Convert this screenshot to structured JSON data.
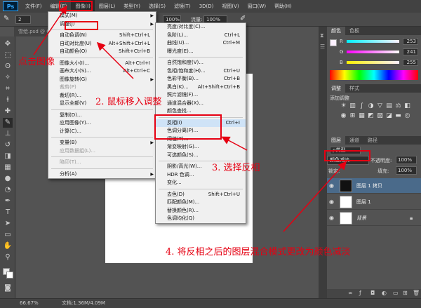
{
  "menubar": {
    "logo": "Ps",
    "items": [
      "文件(F)",
      "编辑(E)",
      "图像(I)",
      "图层(L)",
      "类型(Y)",
      "选择(S)",
      "滤镜(T)",
      "3D(D)",
      "视图(V)",
      "窗口(W)",
      "帮助(H)"
    ]
  },
  "optbar": {
    "brush_size": "2",
    "opacity_value": "100%",
    "flow_label": "流量:",
    "flow_value": "100%"
  },
  "document_tab": "雪绘.psd @ 66.67%",
  "image_menu": {
    "items": [
      {
        "label": "模式(M)",
        "shortcut": "",
        "submenu": true
      },
      {
        "label": "调整(J)",
        "shortcut": "",
        "submenu": true
      },
      {
        "sep": true
      },
      {
        "label": "自动色调(N)",
        "shortcut": "Shift+Ctrl+L"
      },
      {
        "label": "自动对比度(U)",
        "shortcut": "Alt+Shift+Ctrl+L"
      },
      {
        "label": "自动颜色(O)",
        "shortcut": "Shift+Ctrl+B"
      },
      {
        "sep": true
      },
      {
        "label": "图像大小(I)...",
        "shortcut": "Alt+Ctrl+I"
      },
      {
        "label": "画布大小(S)...",
        "shortcut": "Alt+Ctrl+C"
      },
      {
        "label": "图像旋转(G)",
        "shortcut": "",
        "submenu": true
      },
      {
        "label": "裁剪(P)",
        "shortcut": "",
        "disabled": true
      },
      {
        "label": "裁切(R)...",
        "shortcut": ""
      },
      {
        "label": "显示全部(V)",
        "shortcut": ""
      },
      {
        "sep": true
      },
      {
        "label": "复制(D)...",
        "shortcut": ""
      },
      {
        "label": "应用图像(Y)...",
        "shortcut": ""
      },
      {
        "label": "计算(C)...",
        "shortcut": ""
      },
      {
        "sep": true
      },
      {
        "label": "变量(B)",
        "shortcut": "",
        "submenu": true
      },
      {
        "label": "应用数据组(L)...",
        "shortcut": "",
        "disabled": true
      },
      {
        "sep": true
      },
      {
        "label": "陷印(T)...",
        "shortcut": "",
        "disabled": true
      },
      {
        "sep": true
      },
      {
        "label": "分析(A)",
        "shortcut": "",
        "submenu": true
      }
    ]
  },
  "adjust_menu": {
    "items": [
      {
        "label": "亮度/对比度(C)...",
        "shortcut": ""
      },
      {
        "label": "色阶(L)...",
        "shortcut": "Ctrl+L"
      },
      {
        "label": "曲线(U)...",
        "shortcut": "Ctrl+M"
      },
      {
        "label": "曝光度(E)...",
        "shortcut": ""
      },
      {
        "sep": true
      },
      {
        "label": "自然饱和度(V)...",
        "shortcut": ""
      },
      {
        "label": "色相/饱和度(H)...",
        "shortcut": "Ctrl+U"
      },
      {
        "label": "色彩平衡(B)...",
        "shortcut": "Ctrl+B"
      },
      {
        "label": "黑白(K)...",
        "shortcut": "Alt+Shift+Ctrl+B"
      },
      {
        "label": "照片滤镜(F)...",
        "shortcut": ""
      },
      {
        "label": "通道混合器(X)...",
        "shortcut": ""
      },
      {
        "label": "颜色查找...",
        "shortcut": ""
      },
      {
        "sep": true
      },
      {
        "label": "反相(I)",
        "shortcut": "Ctrl+I",
        "highlight": true
      },
      {
        "label": "色调分离(P)...",
        "shortcut": ""
      },
      {
        "label": "阈值(T)...",
        "shortcut": ""
      },
      {
        "label": "渐变映射(G)...",
        "shortcut": ""
      },
      {
        "label": "可选颜色(S)...",
        "shortcut": ""
      },
      {
        "sep": true
      },
      {
        "label": "阴影/高光(W)...",
        "shortcut": ""
      },
      {
        "label": "HDR 色调...",
        "shortcut": ""
      },
      {
        "label": "变化...",
        "shortcut": ""
      },
      {
        "sep": true
      },
      {
        "label": "去色(D)",
        "shortcut": "Shift+Ctrl+U"
      },
      {
        "label": "匹配颜色(M)...",
        "shortcut": ""
      },
      {
        "label": "替换颜色(R)...",
        "shortcut": ""
      },
      {
        "label": "色调均化(Q)",
        "shortcut": ""
      }
    ]
  },
  "color_panel": {
    "tabs": [
      "颜色",
      "色板"
    ],
    "channels": [
      {
        "name": "R",
        "value": "253"
      },
      {
        "name": "G",
        "value": "241"
      },
      {
        "name": "B",
        "value": "255"
      }
    ]
  },
  "adjust_panel": {
    "tabs": [
      "调整",
      "样式"
    ],
    "title": "添加调整",
    "icons": [
      "brightness-icon",
      "levels-icon",
      "curves-icon",
      "exposure-icon",
      "vibrance-icon",
      "hue-sat-icon",
      "color-balance-icon",
      "bw-icon",
      "photo-filter-icon",
      "channel-mixer-icon",
      "color-lookup-icon",
      "invert-icon",
      "posterize-icon",
      "threshold-icon",
      "gradient-map-icon",
      "selective-color-icon"
    ]
  },
  "layers_panel": {
    "tabs": [
      "图层",
      "通道",
      "路径"
    ],
    "kind_label": "ρ类型",
    "blend_mode": "颜色减淡",
    "opacity_label": "不透明度:",
    "opacity_value": "100%",
    "lock_label": "锁定:",
    "fill_label": "填充:",
    "fill_value": "100%",
    "layers": [
      {
        "name": "图层 1 拷贝",
        "selected": true
      },
      {
        "name": "图层 1",
        "selected": false
      },
      {
        "name": "背景",
        "selected": false
      }
    ]
  },
  "statusbar": {
    "zoom": "66.67%",
    "doc": "文档:1.36M/4.09M"
  },
  "annotations": {
    "step1": "点击图像",
    "step2": "2. 鼠标移入调整",
    "step3": "3. 选择反相",
    "step4": "4. 将反相之后的图层混合模式更改为颜色减淡"
  },
  "colors": {
    "annotation_red": "#e60012",
    "selected_layer": "#4a6a8a"
  }
}
